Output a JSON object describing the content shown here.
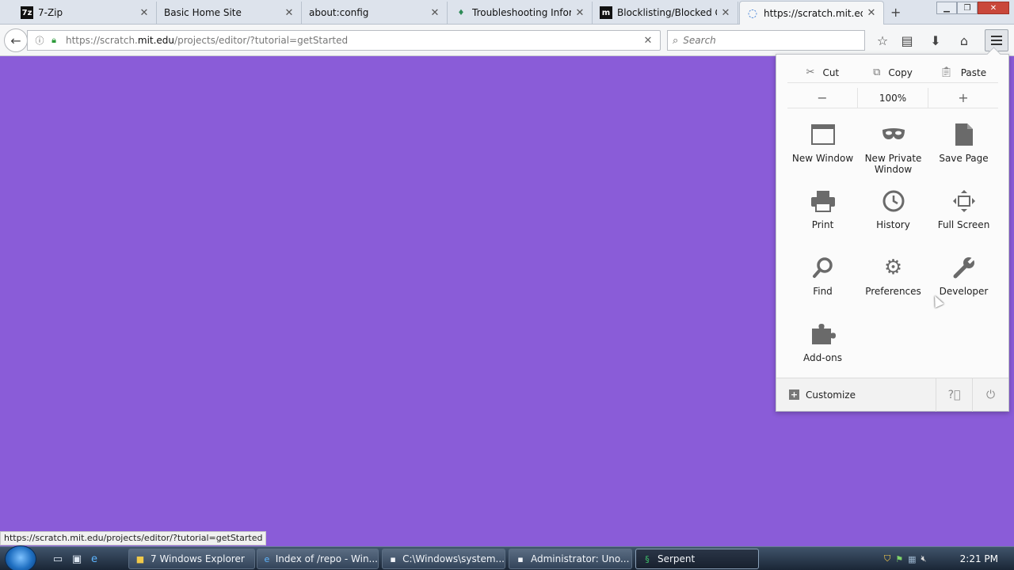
{
  "tabs": [
    {
      "title": "7-Zip",
      "favicon": "7z-icon",
      "fav_text": "7z"
    },
    {
      "title": "Basic Home Site",
      "favicon": "blank-page-icon",
      "fav_text": ""
    },
    {
      "title": "about:config",
      "favicon": "blank-page-icon",
      "fav_text": ""
    },
    {
      "title": "Troubleshooting Infor",
      "favicon": "puzzle-icon",
      "fav_text": "♦"
    },
    {
      "title": "Blocklisting/Blocked Gr",
      "favicon": "mdn-icon",
      "fav_text": "m"
    },
    {
      "title": "https://scratch.mit.edu",
      "favicon": "loading-spinner-icon",
      "fav_text": "◌"
    }
  ],
  "address_bar": {
    "url_prefix": "https://scratch.",
    "url_domain": "mit.edu",
    "url_path": "/projects/editor/?tutorial=getStarted"
  },
  "search": {
    "placeholder": "Search"
  },
  "menu_panel": {
    "cut": "Cut",
    "copy": "Copy",
    "paste": "Paste",
    "zoom_out": "−",
    "zoom_level": "100%",
    "zoom_in": "+",
    "items": [
      {
        "label": "New Window",
        "icon": "new-window-icon"
      },
      {
        "label": "New Private Window",
        "icon": "private-mask-icon"
      },
      {
        "label": "Save Page",
        "icon": "save-page-icon"
      },
      {
        "label": "Print",
        "icon": "printer-icon"
      },
      {
        "label": "History",
        "icon": "clock-icon"
      },
      {
        "label": "Full Screen",
        "icon": "fullscreen-icon"
      },
      {
        "label": "Find",
        "icon": "magnifier-icon"
      },
      {
        "label": "Preferences",
        "icon": "gear-icon"
      },
      {
        "label": "Developer",
        "icon": "wrench-icon"
      },
      {
        "label": "Add-ons",
        "icon": "puzzle-piece-icon"
      }
    ],
    "customize": "Customize"
  },
  "status_text": "https://scratch.mit.edu/projects/editor/?tutorial=getStarted",
  "taskbar": {
    "tasks": [
      {
        "label": "7 Windows Explorer",
        "icon": "folder-icon"
      },
      {
        "label": "Index of /repo - Win...",
        "icon": "ie-icon"
      },
      {
        "label": "C:\\Windows\\system...",
        "icon": "cmd-icon"
      },
      {
        "label": "Administrator:  Uno...",
        "icon": "cmd-icon"
      },
      {
        "label": "Serpent",
        "icon": "serpent-icon"
      }
    ],
    "clock": "2:21 PM"
  },
  "colors": {
    "page_background": "#8a5cd8"
  }
}
